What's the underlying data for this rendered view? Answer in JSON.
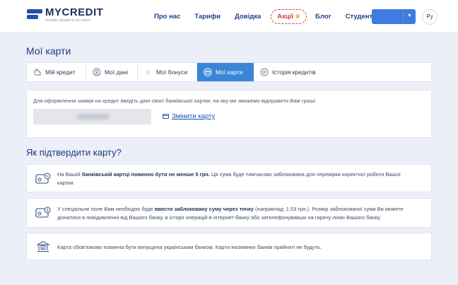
{
  "header": {
    "logo_title": "MYCREDIT",
    "logo_sub": "онлайн кредити на карту",
    "nav": [
      "Про нас",
      "Тарифи",
      "Довідка"
    ],
    "promo": "Акції",
    "nav_after": [
      "Блог",
      "Студентам"
    ],
    "lang": "Ру"
  },
  "page": {
    "title": "Мої карти"
  },
  "tabs": [
    {
      "label": "Мій кредит",
      "icon": "hand-icon"
    },
    {
      "label": "Мої дані",
      "icon": "user-icon"
    },
    {
      "label": "Мої бонуси",
      "icon": "star-icon"
    },
    {
      "label": "Мої карти",
      "icon": "card-icon",
      "active": true
    },
    {
      "label": "Історія кредитів",
      "icon": "list-icon"
    }
  ],
  "card": {
    "instruction": "Для оформлення заявки на кредит введіть дані своєї банківської картки, на яку ми зможемо відправити Вам гроші:",
    "change_label": "Змінити карту"
  },
  "confirm": {
    "title": "Як підтвердити карту?",
    "items": [
      {
        "icon": "card-lock-icon",
        "pre": "На Вашій ",
        "bold": "банківській картці повинно бути не менше 5 грн.",
        "post": " Ця сума буде тимчасово заблокована для перевірки коректної роботи Вашої картки."
      },
      {
        "icon": "card-amount-icon",
        "pre": "У спеціальне поле Вам необхідно буде ",
        "bold": "ввести заблоковану суму через точку",
        "post": " (наприклад: 1.53 грн.). Розмір заблокованої суми Ви можете дізнатися в повідомленні від Вашого банку, в історії операцій в інтернет-банку або зателефонувавши на гарячу лінію Вашого банку."
      },
      {
        "icon": "bank-icon",
        "pre": "Карта обов'язково повинна бути випущена українським банком. Карти іноземних банків прийняті не будуть.",
        "bold": "",
        "post": ""
      }
    ]
  },
  "colors": {
    "brand": "#1e2f5a",
    "accent": "#3a86d6",
    "promo": "#d63a4a",
    "background": "#eceef8"
  }
}
